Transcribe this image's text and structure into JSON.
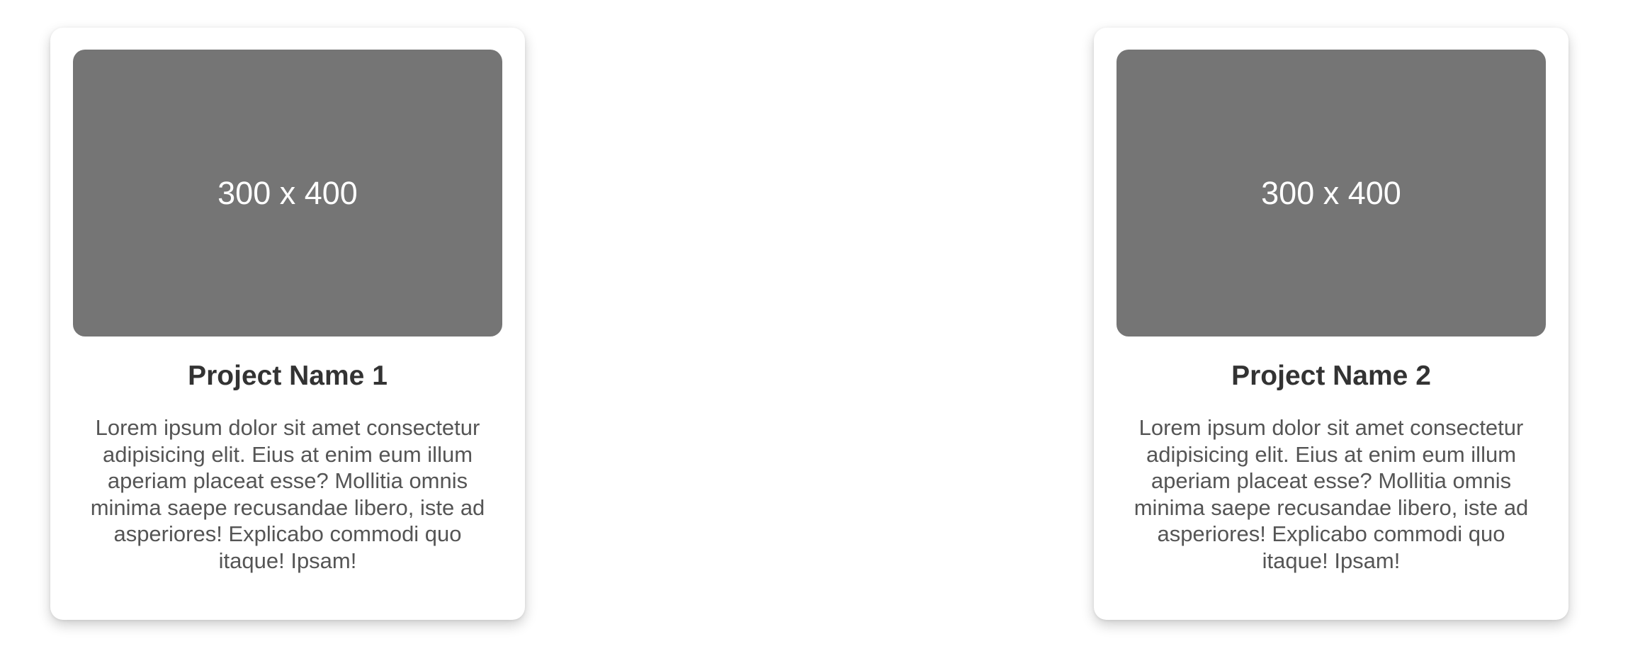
{
  "projects": [
    {
      "image_placeholder": "300 x 400",
      "title": "Project Name 1",
      "description": "Lorem ipsum dolor sit amet consectetur adipisicing elit. Eius at enim eum illum aperiam placeat esse? Mollitia omnis minima saepe recusandae libero, iste ad asperiores! Explicabo commodi quo itaque! Ipsam!"
    },
    {
      "image_placeholder": "300 x 400",
      "title": "Project Name 2",
      "description": "Lorem ipsum dolor sit amet consectetur adipisicing elit. Eius at enim eum illum aperiam placeat esse? Mollitia omnis minima saepe recusandae libero, iste ad asperiores! Explicabo commodi quo itaque! Ipsam!"
    }
  ],
  "colors": {
    "placeholder_background": "#757575",
    "title_text": "#333333",
    "description_text": "#555555",
    "card_background": "#ffffff"
  }
}
